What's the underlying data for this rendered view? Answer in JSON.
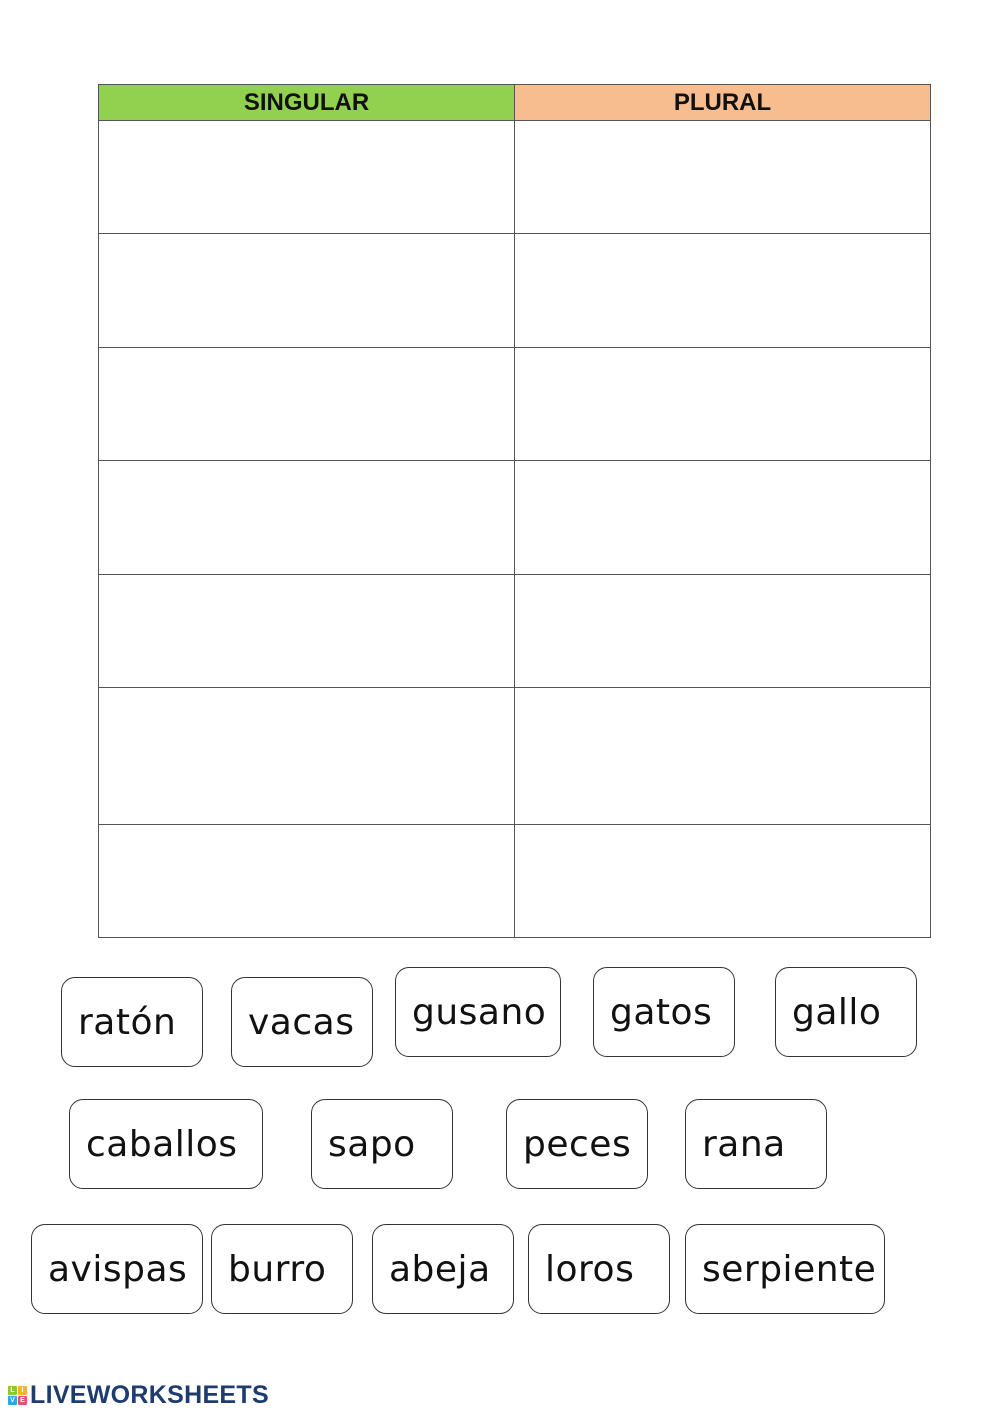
{
  "table": {
    "headers": {
      "singular": "SINGULAR",
      "plural": "PLURAL"
    },
    "header_colors": {
      "singular": "#92d050",
      "plural": "#f8bd8f"
    },
    "row_count": 7
  },
  "word_cards": [
    {
      "word": "ratón"
    },
    {
      "word": "vacas"
    },
    {
      "word": "gusano"
    },
    {
      "word": "gatos"
    },
    {
      "word": "gallo"
    },
    {
      "word": "caballos"
    },
    {
      "word": "sapo"
    },
    {
      "word": "peces"
    },
    {
      "word": "rana"
    },
    {
      "word": "avispas"
    },
    {
      "word": "burro"
    },
    {
      "word": "abeja"
    },
    {
      "word": "loros"
    },
    {
      "word": "serpiente"
    }
  ],
  "footer": {
    "logo_icon": "live-blocks-icon",
    "logo_letters": [
      "L",
      "I",
      "V",
      "E"
    ],
    "brand": "LIVEWORKSHEETS"
  }
}
